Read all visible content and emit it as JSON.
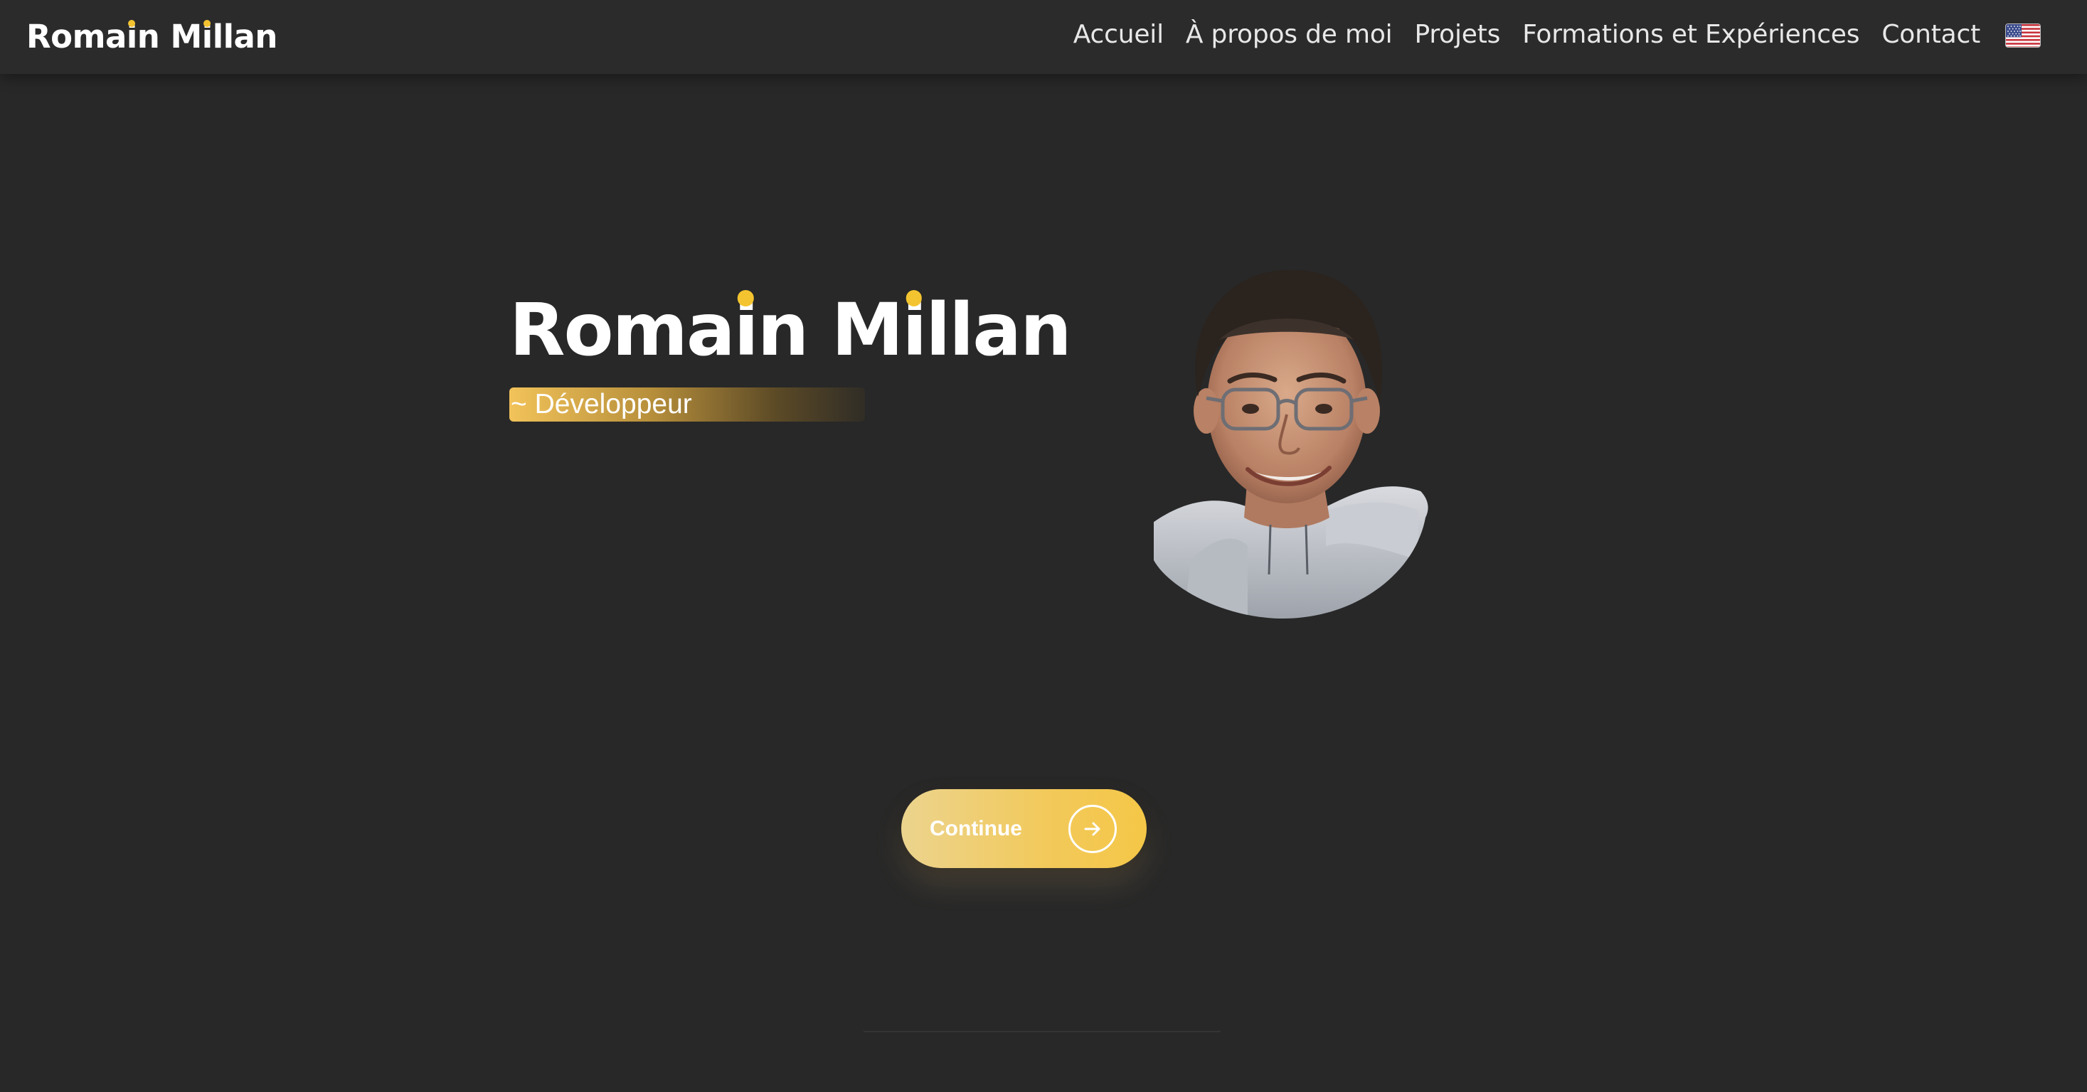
{
  "header": {
    "brand": {
      "part1": "Roma",
      "i1": "i",
      "part2": "n M",
      "i2": "i",
      "part3": "llan"
    },
    "nav": {
      "home": "Accueil",
      "about": "À propos de moi",
      "projects": "Projets",
      "education": "Formations et Expériences",
      "contact": "Contact"
    },
    "language_flag": "us-flag-icon"
  },
  "hero": {
    "name": {
      "part1": "Roma",
      "i1": "i",
      "part2": "n M",
      "i2": "i",
      "part3": "llan"
    },
    "role": "~ Développeur",
    "avatar": "profile-photo"
  },
  "cta": {
    "label": "Continue",
    "icon": "arrow-right-icon"
  },
  "colors": {
    "background": "#282828",
    "navbar": "#2b2b2b",
    "accent": "#f4c430",
    "button": "#f2c95a"
  }
}
